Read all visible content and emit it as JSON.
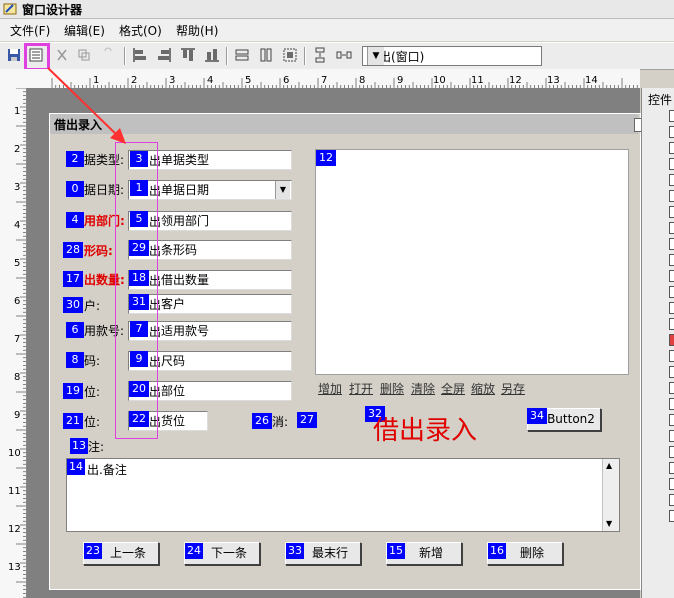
{
  "window": {
    "title": "窗口设计器"
  },
  "menu": [
    "文件(F)",
    "编辑(E)",
    "格式(O)",
    "帮助(H)"
  ],
  "toolbar": {
    "combo_value": "借出(窗口)"
  },
  "ruler": {
    "h": [
      "1",
      "2",
      "3",
      "4",
      "5",
      "6",
      "7",
      "8",
      "9",
      "10",
      "11",
      "12",
      "13",
      "14"
    ],
    "v": [
      "1",
      "2",
      "3",
      "4",
      "5",
      "6",
      "7",
      "8",
      "9",
      "10",
      "11",
      "12",
      "13"
    ]
  },
  "right_panel": {
    "header": "控件"
  },
  "form": {
    "title": "借出录入",
    "rows": [
      {
        "badge": "2",
        "label": "据类型:",
        "red": false,
        "fbadge": "3",
        "fprefix": "出",
        "value": "单据类型"
      },
      {
        "badge": "0",
        "label": "据日期:",
        "red": false,
        "fbadge": "1",
        "fprefix": "出",
        "value": "单据日期"
      },
      {
        "badge": "4",
        "label": "用部门:",
        "red": true,
        "fbadge": "5",
        "fprefix": "出",
        "value": "领用部门"
      },
      {
        "badge": "28",
        "label": "形码:",
        "red": true,
        "fbadge": "29",
        "fprefix": "出",
        "value": "条形码"
      },
      {
        "badge": "17",
        "label": "出数量:",
        "red": true,
        "fbadge": "18",
        "fprefix": "出",
        "value": "借出数量"
      },
      {
        "badge": "30",
        "label": "户:",
        "red": false,
        "fbadge": "31",
        "fprefix": "出",
        "value": "客户"
      },
      {
        "badge": "6",
        "label": "用款号:",
        "red": false,
        "fbadge": "7",
        "fprefix": "出",
        "value": "适用款号"
      },
      {
        "badge": "8",
        "label": "码:",
        "red": false,
        "fbadge": "9",
        "fprefix": "出",
        "value": "尺码"
      },
      {
        "badge": "19",
        "label": "位:",
        "red": false,
        "fbadge": "20",
        "fprefix": "出",
        "value": "部位"
      },
      {
        "badge": "21",
        "label": "位:",
        "red": false,
        "fbadge": "22",
        "fprefix": "出",
        "value": "货位"
      }
    ],
    "image_badge": "12",
    "image_links": [
      "增加",
      "打开",
      "删除",
      "清除",
      "全屏",
      "缩放",
      "另存"
    ],
    "extra": {
      "badge26": "26",
      "label26": "消:",
      "badge27": "27",
      "badge32": "32",
      "badge34": "34",
      "button2_label": "Button2"
    },
    "big_title": "借出录入",
    "remark": {
      "badge": "13",
      "label": "注:",
      "memo_badge": "14",
      "memo_text": "出.备注"
    },
    "buttons": [
      {
        "badge": "23",
        "label": "上一条"
      },
      {
        "badge": "24",
        "label": "下一条"
      },
      {
        "badge": "33",
        "label": "最末行"
      },
      {
        "badge": "15",
        "label": "新增"
      },
      {
        "badge": "16",
        "label": "删除"
      }
    ]
  },
  "colors": {
    "highlight": "#e040e0",
    "badge": "#0000ff",
    "red_text": "#e00000",
    "arrow": "#ff3030"
  }
}
